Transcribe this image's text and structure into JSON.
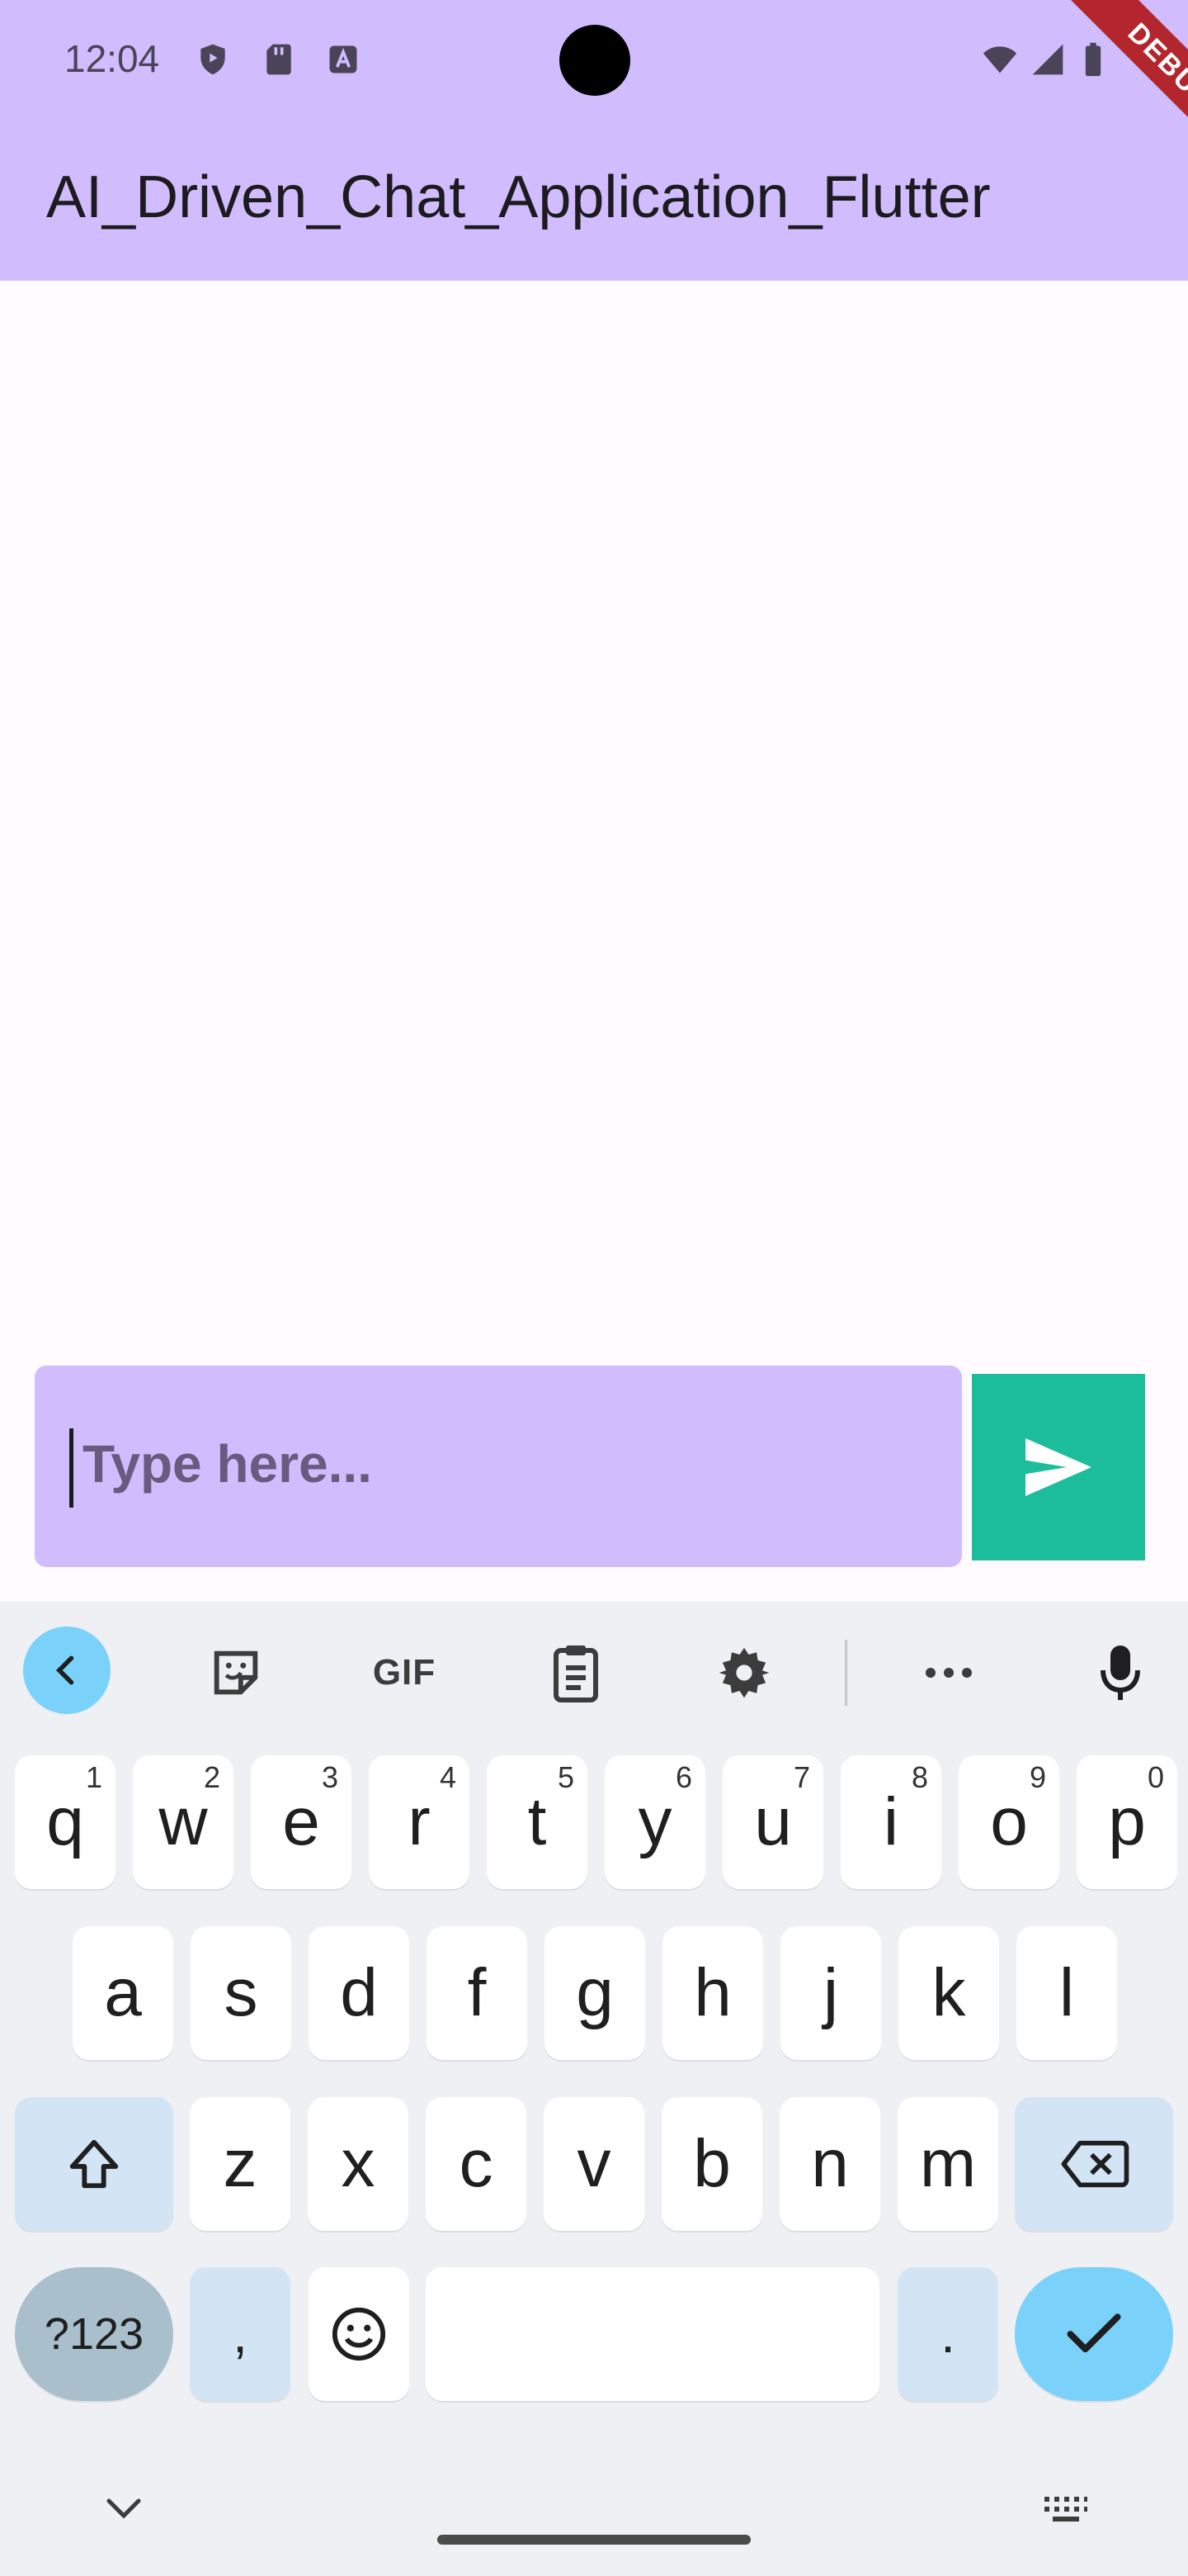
{
  "status_bar": {
    "time": "12:04",
    "icons": [
      "shield-icon",
      "sdcard-icon",
      "font-icon",
      "wifi-icon",
      "signal-icon",
      "battery-icon"
    ]
  },
  "app_bar": {
    "title": "AI_Driven_Chat_Application_Flutter",
    "debug_badge": "DEBUG"
  },
  "composer": {
    "placeholder": "Type here...",
    "send_icon": "send-icon"
  },
  "keyboard": {
    "toolbar": [
      "collapse-icon",
      "sticker-icon",
      "gif-icon",
      "clipboard-icon",
      "settings-icon",
      "more-icon",
      "mic-icon"
    ],
    "gif_label": "GIF",
    "row1": [
      {
        "k": "q",
        "h": "1"
      },
      {
        "k": "w",
        "h": "2"
      },
      {
        "k": "e",
        "h": "3"
      },
      {
        "k": "r",
        "h": "4"
      },
      {
        "k": "t",
        "h": "5"
      },
      {
        "k": "y",
        "h": "6"
      },
      {
        "k": "u",
        "h": "7"
      },
      {
        "k": "i",
        "h": "8"
      },
      {
        "k": "o",
        "h": "9"
      },
      {
        "k": "p",
        "h": "0"
      }
    ],
    "row2": [
      "a",
      "s",
      "d",
      "f",
      "g",
      "h",
      "j",
      "k",
      "l"
    ],
    "row3": [
      "z",
      "x",
      "c",
      "v",
      "b",
      "n",
      "m"
    ],
    "symbols_label": "?123",
    "comma_label": ",",
    "period_label": ".",
    "colors": {
      "accent": "#7ad2fb",
      "appbar": "#d1bcfd",
      "send": "#1bbd9a"
    }
  }
}
